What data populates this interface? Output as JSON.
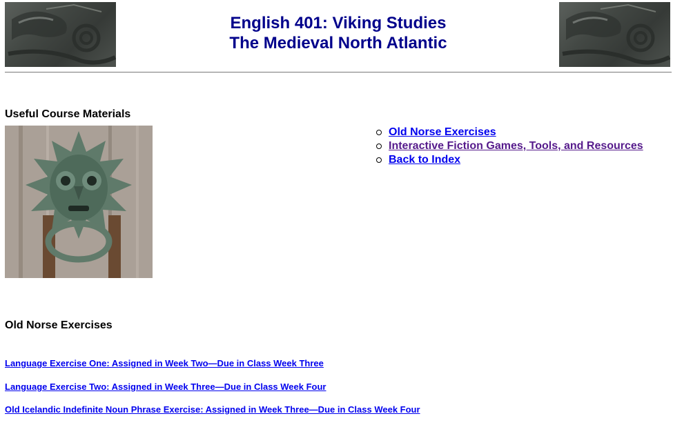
{
  "header": {
    "title_line1": "English 401: Viking Studies",
    "title_line2": "The Medieval North Atlantic"
  },
  "materials": {
    "heading": "Useful Course Materials",
    "links": [
      {
        "label": "Old Norse Exercises"
      },
      {
        "label": "Interactive Fiction Games, Tools, and Resources"
      },
      {
        "label": "Back to Index"
      }
    ]
  },
  "exercises": {
    "heading": "Old Norse Exercises",
    "items": [
      {
        "label": "Language Exercise One: Assigned in Week Two—Due in Class Week Three"
      },
      {
        "label": "Language Exercise Two: Assigned in Week Three—Due in Class Week Four"
      },
      {
        "label": "Old Icelandic Indefinite Noun Phrase Exercise: Assigned in Week Three—Due in Class Week Four"
      }
    ]
  },
  "colors": {
    "title": "#00008b",
    "link": "#0000ee",
    "visited_link": "#551a8b"
  }
}
